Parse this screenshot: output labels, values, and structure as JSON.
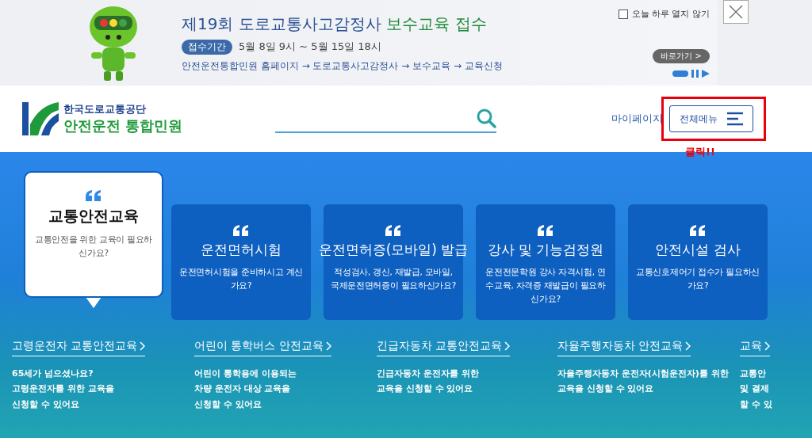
{
  "banner": {
    "title": "제19회 도로교통사고감정사",
    "title_highlight": "보수교육 접수",
    "period_badge": "접수기간",
    "period": "5월 8일 9시 ~ 5월 15일 18시",
    "path": "안전운전통합민원 홈페이지 → 도로교통사고감정사 → 보수교육 →  교육신청",
    "go_button": "바로가기 >",
    "dismiss": {
      "label": "오늘 하루 열지 않기",
      "checked": false
    }
  },
  "header": {
    "logo_top": "한국도로교통공단",
    "logo_main": "안전운전",
    "logo_accent": "통합민원",
    "mypage": "마이페이지",
    "menu_button": "전체메뉴",
    "annotation": "클릭!!"
  },
  "cards": [
    {
      "title": "교통안전교육",
      "desc": "교통안전을 위한 교육이 필요하신가요?",
      "selected": true
    },
    {
      "title": "운전면허시험",
      "desc": "운전면허시험을 준비하시고 계신가요?",
      "selected": false
    },
    {
      "title": "운전면허증(모바일) 발급",
      "desc": "적성검사, 갱신, 재발급, 모바일, 국제운전면허증이 필요하신가요?",
      "selected": false
    },
    {
      "title": "강사 및 기능검정원",
      "desc": "운전전문학원 강사 자격시험, 연수교육, 자격증 재발급이 필요하신가요?",
      "selected": false
    },
    {
      "title": "안전시설 검사",
      "desc": "교통신호제어기 접수가 필요하신가요?",
      "selected": false
    }
  ],
  "links": [
    {
      "title": "고령운전자 교통안전교육",
      "lines": [
        "65세가 넘으셨나요?",
        "고령운전자를 위한 교육을",
        "신청할 수 있어요"
      ]
    },
    {
      "title": "어린이 통학버스 안전교육",
      "lines": [
        "어린이 통학용에 이용되는",
        "차량 운전자 대상 교육을",
        "신청할 수 있어요"
      ]
    },
    {
      "title": "긴급자동차 교통안전교육",
      "lines": [
        "긴급자동차 운전자를 위한",
        "교육을 신청할 수 있어요"
      ]
    },
    {
      "title": "자율주행자동차 안전교육",
      "lines": [
        "자율주행자동차 운전자(시험운전자)를 위한",
        "교육을 신청할 수 있어요"
      ]
    },
    {
      "title": "교육",
      "lines": [
        "교통안",
        "및 결제",
        "할 수 있"
      ]
    }
  ]
}
